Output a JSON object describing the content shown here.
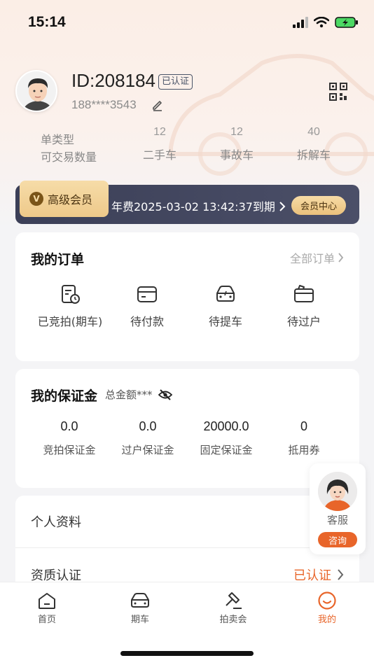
{
  "status_bar": {
    "time": "15:14"
  },
  "profile": {
    "user_id": "ID:208184",
    "verified_label": "已认证",
    "phone": "188****3543",
    "icons": {
      "edit": "edit-icon",
      "qr": "qr-code-icon"
    }
  },
  "stats": {
    "row1_label": "单类型",
    "row2_label": "可交易数量",
    "columns": [
      {
        "count": "12",
        "label": "二手车"
      },
      {
        "count": "12",
        "label": "事故车"
      },
      {
        "count": "40",
        "label": "拆解车"
      }
    ]
  },
  "vip": {
    "coin": "V",
    "tag": "高级会员",
    "expiry": "年费2025-03-02 13:42:37到期",
    "center_button": "会员中心"
  },
  "orders": {
    "title": "我的订单",
    "all_link": "全部订单",
    "items": [
      {
        "label": "已竞拍(期车)",
        "icon": "auction-clock-icon"
      },
      {
        "label": "待付款",
        "icon": "wallet-icon"
      },
      {
        "label": "待提车",
        "icon": "car-icon"
      },
      {
        "label": "待过户",
        "icon": "transfer-doc-icon"
      }
    ]
  },
  "deposit": {
    "title": "我的保证金",
    "total_label": "总金额***",
    "items": [
      {
        "value": "0.0",
        "label": "竞拍保证金"
      },
      {
        "value": "0.0",
        "label": "过户保证金"
      },
      {
        "value": "20000.0",
        "label": "固定保证金"
      },
      {
        "value": "0",
        "label": "抵用券"
      }
    ]
  },
  "menu": {
    "profile_label": "个人资料",
    "qualification_label": "资质认证",
    "qualification_status": "已认证"
  },
  "customer_service": {
    "label": "客服",
    "button": "咨询"
  },
  "tabs": [
    {
      "label": "首页",
      "icon": "home-icon",
      "active": false
    },
    {
      "label": "期车",
      "icon": "car-icon",
      "active": false
    },
    {
      "label": "拍卖会",
      "icon": "gavel-icon",
      "active": false
    },
    {
      "label": "我的",
      "icon": "smile-icon",
      "active": true
    }
  ],
  "colors": {
    "accent": "#e8652a",
    "vip_bar": "#3b3f57",
    "vip_gold": "#eec98a",
    "hero_bg": "#fbeee6"
  }
}
